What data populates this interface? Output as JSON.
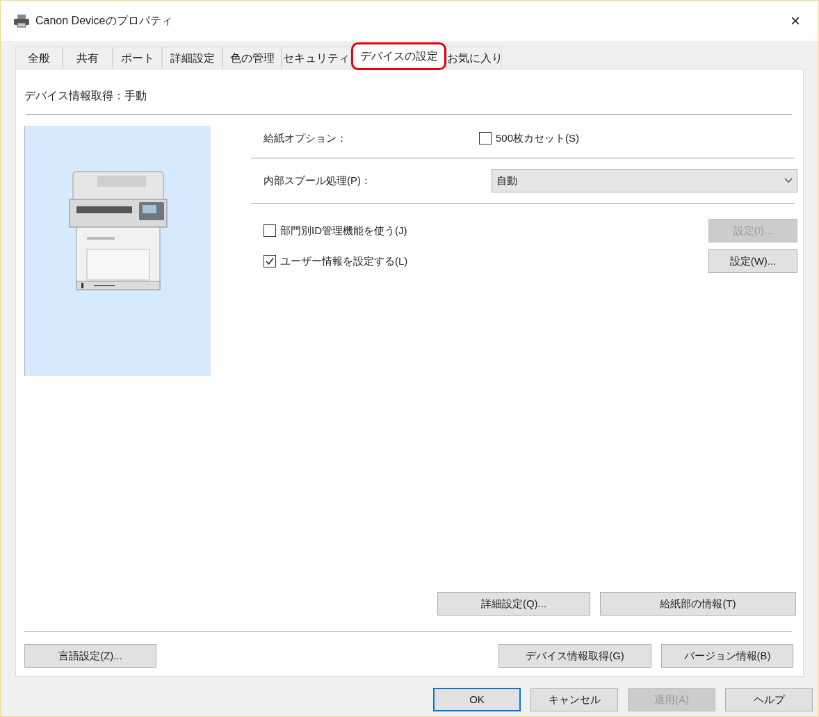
{
  "window": {
    "title": "Canon Deviceのプロパティ",
    "close": "×"
  },
  "tabs": [
    {
      "label": "全般",
      "selected": false
    },
    {
      "label": "共有",
      "selected": false
    },
    {
      "label": "ポート",
      "selected": false
    },
    {
      "label": "詳細設定",
      "selected": false
    },
    {
      "label": "色の管理",
      "selected": false
    },
    {
      "label": "セキュリティ",
      "selected": false
    },
    {
      "label": "デバイスの設定",
      "selected": true
    },
    {
      "label": "お気に入り",
      "selected": false
    }
  ],
  "device_info_status": "デバイス情報取得：手動",
  "paper_option": {
    "label": "給紙オプション：",
    "checkbox": {
      "label": "500枚カセット(S)",
      "checked": false
    }
  },
  "spool": {
    "label": "内部スプール処理(P)：",
    "value": "自動"
  },
  "options": [
    {
      "label": "部門別ID管理機能を使う(J)",
      "checked": false,
      "button": {
        "label": "設定(I)...",
        "disabled": true
      }
    },
    {
      "label": "ユーザー情報を設定する(L)",
      "checked": true,
      "button": {
        "label": "設定(W)...",
        "disabled": false
      }
    }
  ],
  "panel_buttons": [
    "詳細設定(Q)...",
    "給紙部の情報(T)"
  ],
  "footer_left": "言語設定(Z)...",
  "footer_right": [
    "デバイス情報取得(G)",
    "バージョン情報(B)"
  ],
  "dialog_buttons": [
    {
      "label": "OK",
      "disabled": false,
      "default": true
    },
    {
      "label": "キャンセル",
      "disabled": false,
      "default": false
    },
    {
      "label": "適用(A)",
      "disabled": true,
      "default": false
    },
    {
      "label": "ヘルプ",
      "disabled": false,
      "default": false
    }
  ]
}
